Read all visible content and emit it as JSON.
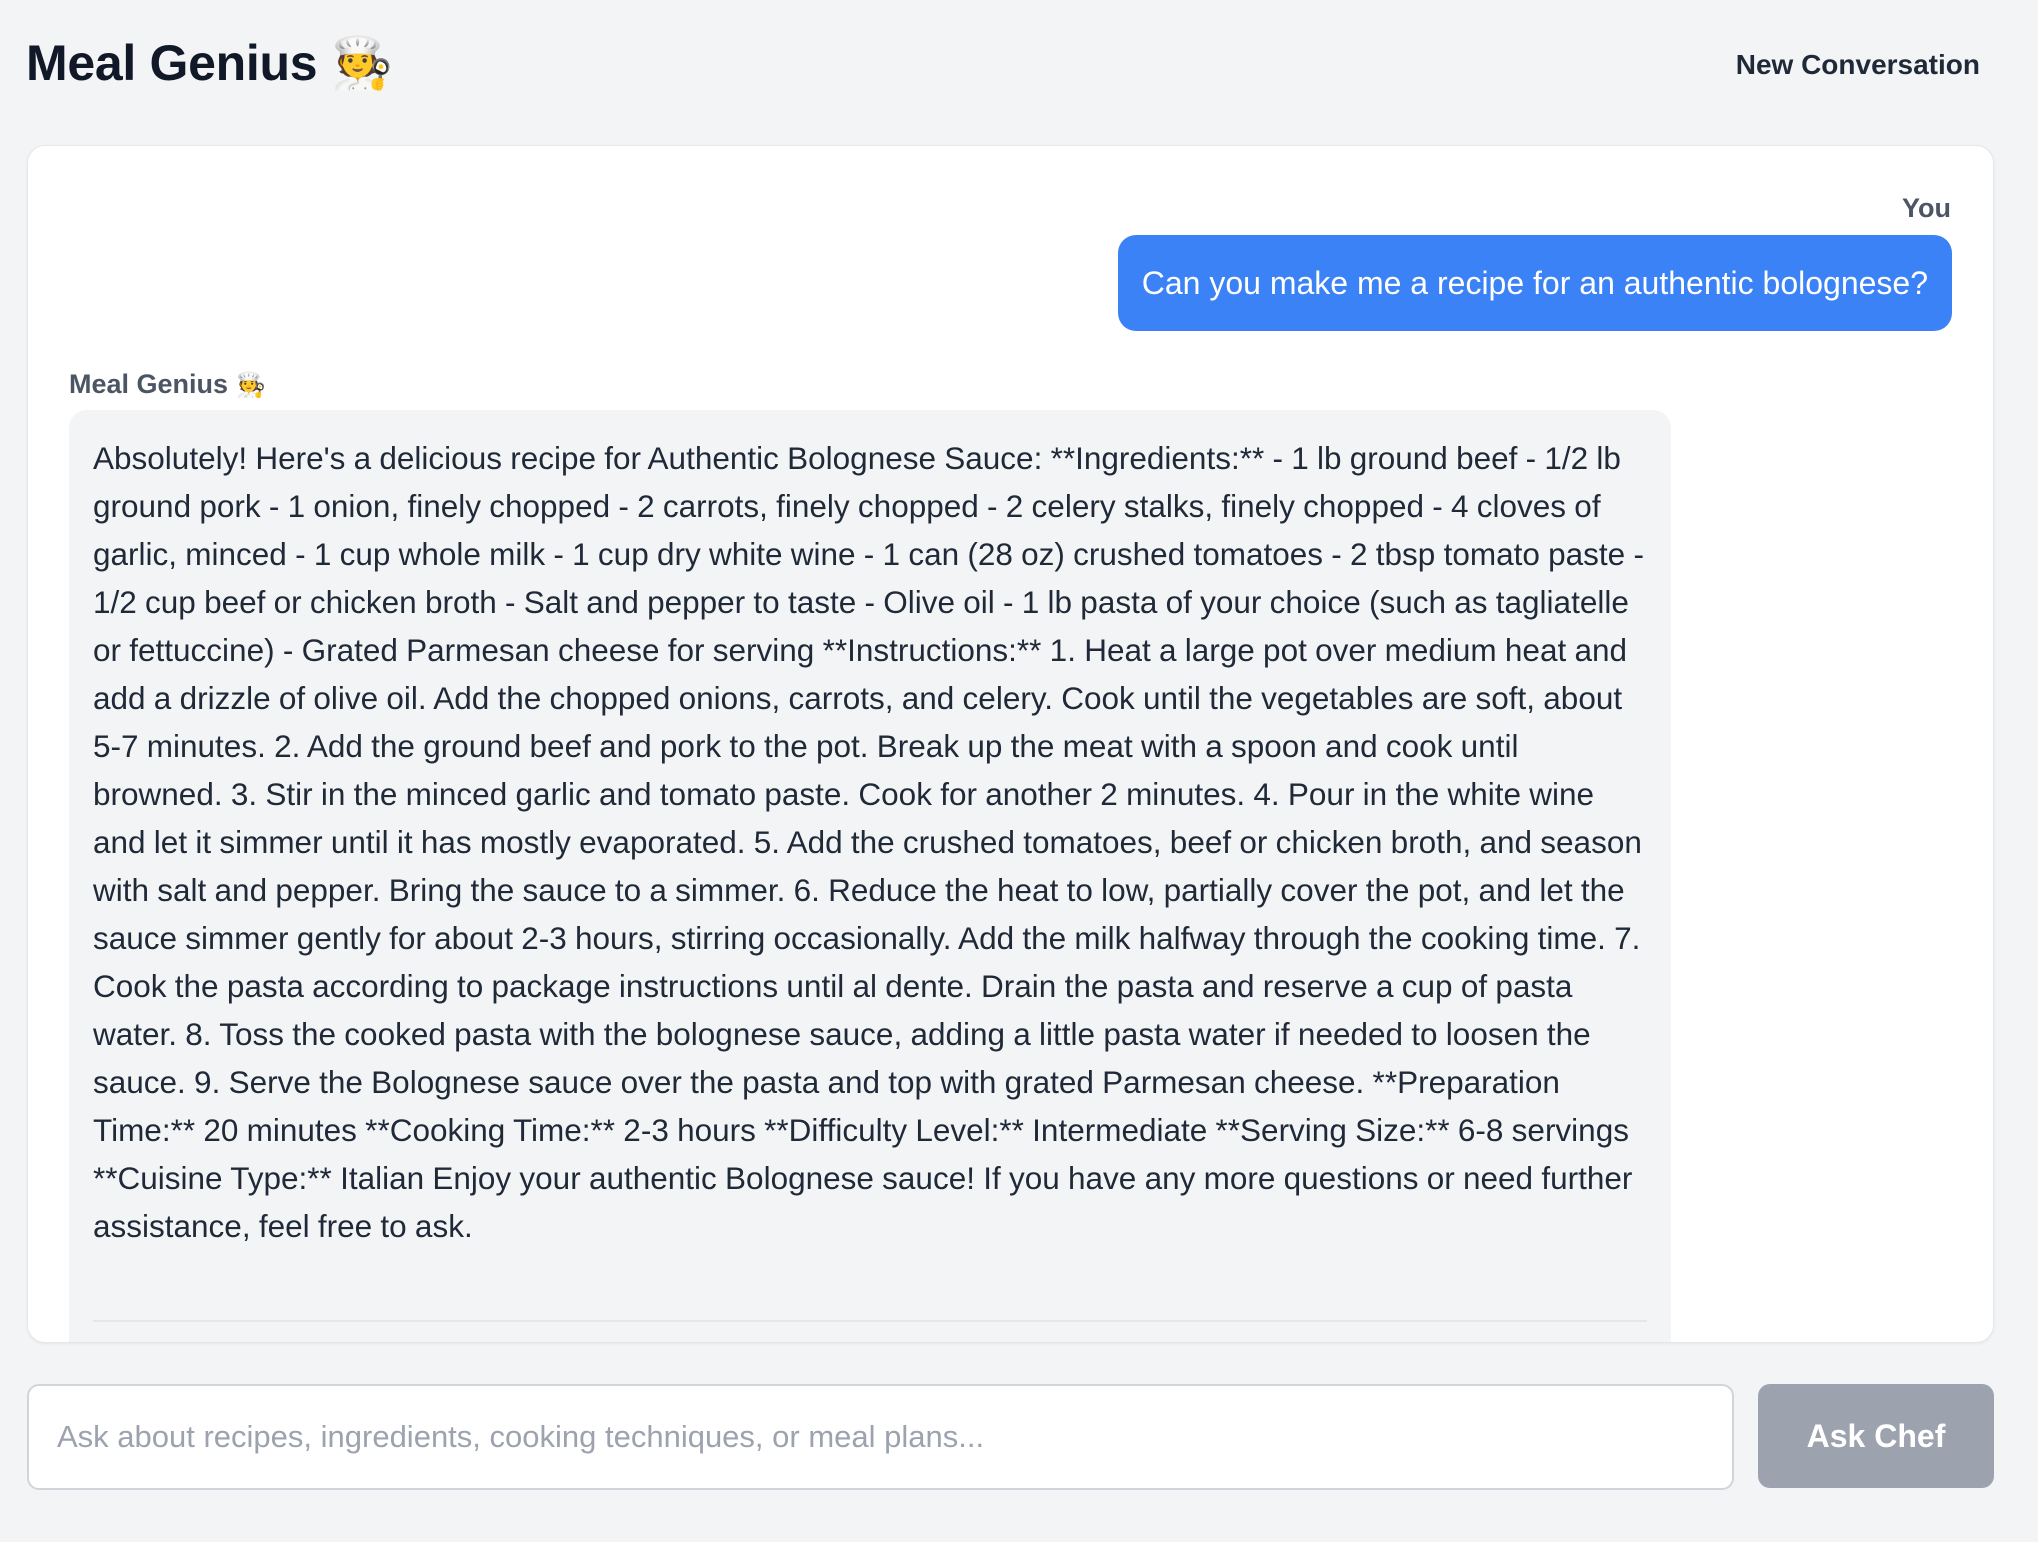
{
  "header": {
    "title": "Meal Genius",
    "title_emoji": "🧑‍🍳",
    "new_conversation_label": "New Conversation"
  },
  "chat": {
    "messages": [
      {
        "role": "user",
        "sender_label": "You",
        "text": "Can you make me a recipe for an authentic bolognese?"
      },
      {
        "role": "assistant",
        "sender_label": "Meal Genius",
        "sender_emoji": "🧑‍🍳",
        "text": "Absolutely! Here's a delicious recipe for Authentic Bolognese Sauce: **Ingredients:** - 1 lb ground beef - 1/2 lb ground pork - 1 onion, finely chopped - 2 carrots, finely chopped - 2 celery stalks, finely chopped - 4 cloves of garlic, minced - 1 cup whole milk - 1 cup dry white wine - 1 can (28 oz) crushed tomatoes - 2 tbsp tomato paste - 1/2 cup beef or chicken broth - Salt and pepper to taste - Olive oil - 1 lb pasta of your choice (such as tagliatelle or fettuccine) - Grated Parmesan cheese for serving **Instructions:** 1. Heat a large pot over medium heat and add a drizzle of olive oil. Add the chopped onions, carrots, and celery. Cook until the vegetables are soft, about 5-7 minutes. 2. Add the ground beef and pork to the pot. Break up the meat with a spoon and cook until browned. 3. Stir in the minced garlic and tomato paste. Cook for another 2 minutes. 4. Pour in the white wine and let it simmer until it has mostly evaporated. 5. Add the crushed tomatoes, beef or chicken broth, and season with salt and pepper. Bring the sauce to a simmer. 6. Reduce the heat to low, partially cover the pot, and let the sauce simmer gently for about 2-3 hours, stirring occasionally. Add the milk halfway through the cooking time. 7. Cook the pasta according to package instructions until al dente. Drain the pasta and reserve a cup of pasta water. 8. Toss the cooked pasta with the bolognese sauce, adding a little pasta water if needed to loosen the sauce. 9. Serve the Bolognese sauce over the pasta and top with grated Parmesan cheese. **Preparation Time:** 20 minutes **Cooking Time:** 2-3 hours **Difficulty Level:** Intermediate **Serving Size:** 6-8 servings **Cuisine Type:** Italian Enjoy your authentic Bolognese sauce! If you have any more questions or need further assistance, feel free to ask."
      }
    ]
  },
  "composer": {
    "placeholder": "Ask about recipes, ingredients, cooking techniques, or meal plans...",
    "value": "",
    "submit_label": "Ask Chef"
  },
  "colors": {
    "background": "#f3f4f6",
    "user_bubble": "#3b82f6",
    "assistant_bubble": "#f3f4f6",
    "submit_disabled": "#9ca3af"
  }
}
